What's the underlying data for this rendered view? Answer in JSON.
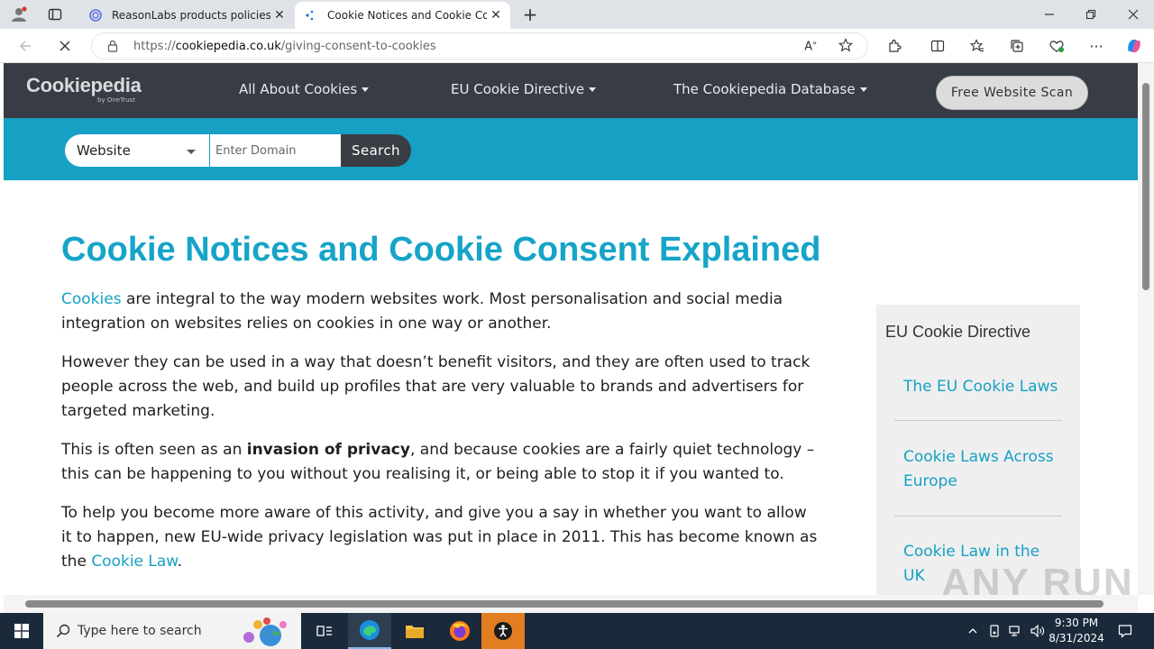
{
  "browser": {
    "tabs": [
      {
        "title": "ReasonLabs products policies",
        "active": false
      },
      {
        "title": "Cookie Notices and Cookie Cons",
        "active": true
      }
    ],
    "url_prefix": "https://",
    "url_host": "cookiepedia.co.uk",
    "url_path": "/giving-consent-to-cookies"
  },
  "site": {
    "logo": "Cookiepedia",
    "logo_sub": "by OneTrust",
    "nav": [
      {
        "label": "All About Cookies"
      },
      {
        "label": "EU Cookie Directive"
      },
      {
        "label": "The Cookiepedia Database"
      }
    ],
    "scan_button": "Free Website Scan",
    "search": {
      "select_value": "Website",
      "placeholder": "Enter Domain",
      "button": "Search"
    }
  },
  "article": {
    "title": "Cookie Notices and Cookie Consent Explained",
    "p1_link": "Cookies",
    "p1_rest": " are integral to the way modern websites work. Most personalisation and social media integration on websites relies on cookies in one way or another.",
    "p2": "However they can be used in a way that doesn’t benefit visitors, and they are often used to track people across the web, and build up profiles that are very valuable to brands and advertisers for targeted marketing.",
    "p3_start": "This is often seen as an ",
    "p3_bold": "invasion of privacy",
    "p3_rest": ", and because cookies are a fairly quiet technology – this can be happening to you without you realising it, or being able to stop it if you wanted to.",
    "p4_start": "To help you become more aware of this activity, and give you a say in whether you want to allow it to happen, new EU-wide privacy legislation was put in place in 2011. This has become known as the ",
    "p4_link": "Cookie Law",
    "p4_end": "."
  },
  "sidebar": {
    "title": "EU Cookie Directive",
    "links": [
      "The EU Cookie Laws",
      "Cookie Laws Across Europe",
      "Cookie Law in the UK"
    ]
  },
  "taskbar": {
    "search_placeholder": "Type here to search",
    "time": "9:30 PM",
    "date": "8/31/2024"
  },
  "watermark": "ANY RUN"
}
